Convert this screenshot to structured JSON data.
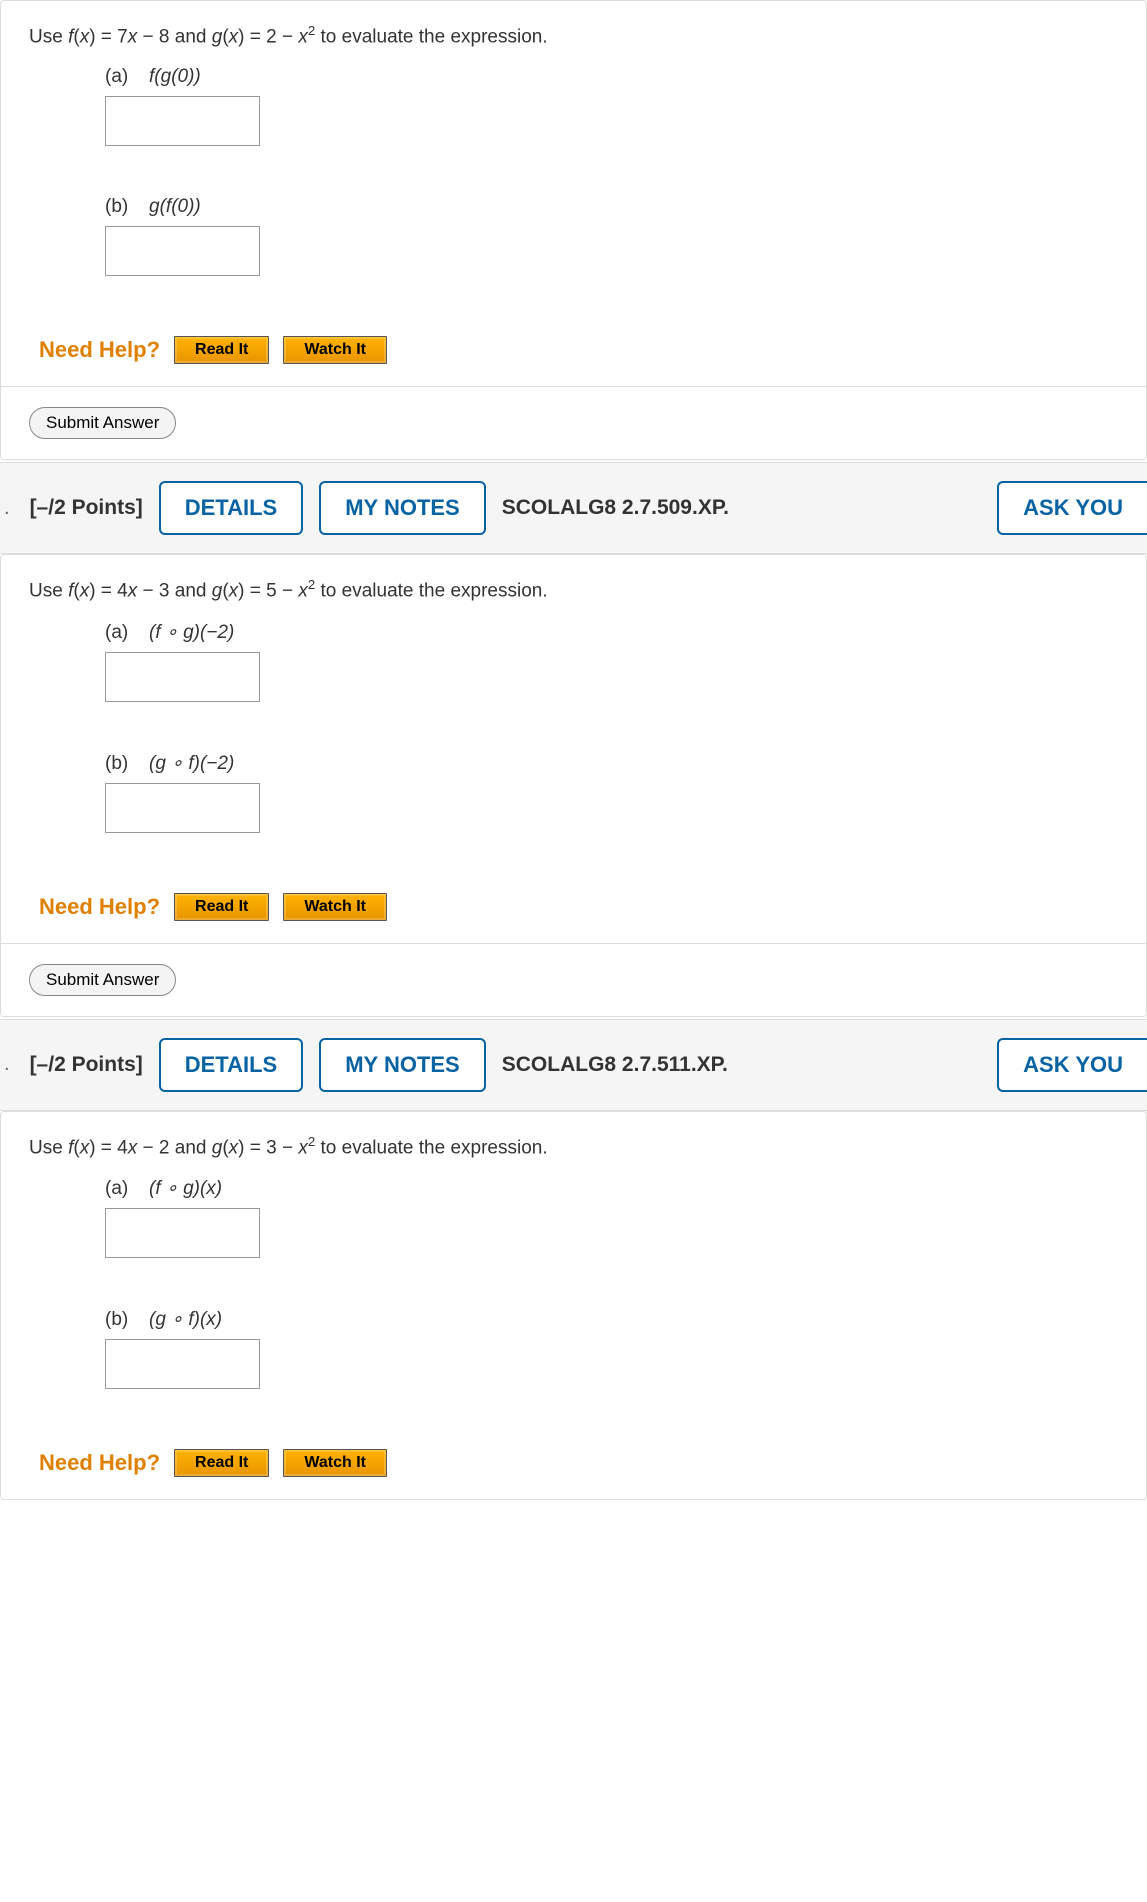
{
  "questions": [
    {
      "prompt_html": "Use <span class='fx'>f</span>(<span class='fx'>x</span>) = 7<span class='fx'>x</span> − 8 and <span class='fx'>g</span>(<span class='fx'>x</span>) = 2 − <span class='fx'>x</span><sup>2</sup> to evaluate the expression.",
      "parts": [
        {
          "label": "(a)",
          "expr_html": "<span class='fx'>f</span>(<span class='fx'>g</span>(0))"
        },
        {
          "label": "(b)",
          "expr_html": "<span class='fx'>g</span>(<span class='fx'>f</span>(0))"
        }
      ],
      "show_header": false
    },
    {
      "points": "[–/2 Points]",
      "reference": "SCOLALG8 2.7.509.XP.",
      "prompt_html": "Use <span class='fx'>f</span>(<span class='fx'>x</span>) = 4<span class='fx'>x</span> − 3 and <span class='fx'>g</span>(<span class='fx'>x</span>) = 5 − <span class='fx'>x</span><sup>2</sup> to evaluate the expression.",
      "parts": [
        {
          "label": "(a)",
          "expr_html": "(<span class='fx'>f</span> ∘ <span class='fx'>g</span>)(−2)"
        },
        {
          "label": "(b)",
          "expr_html": "(<span class='fx'>g</span> ∘ <span class='fx'>f</span>)(−2)"
        }
      ],
      "show_header": true,
      "show_submit": true
    },
    {
      "points": "[–/2 Points]",
      "reference": "SCOLALG8 2.7.511.XP.",
      "prompt_html": "Use <span class='fx'>f</span>(<span class='fx'>x</span>) = 4<span class='fx'>x</span> − 2 and <span class='fx'>g</span>(<span class='fx'>x</span>) = 3 − <span class='fx'>x</span><sup>2</sup> to evaluate the expression.",
      "parts": [
        {
          "label": "(a)",
          "expr_html": "(<span class='fx'>f</span> ∘ <span class='fx'>g</span>)(<span class='fx'>x</span>)"
        },
        {
          "label": "(b)",
          "expr_html": "(<span class='fx'>g</span> ∘ <span class='fx'>f</span>)(<span class='fx'>x</span>)"
        }
      ],
      "show_header": true,
      "show_submit": false
    }
  ],
  "labels": {
    "details": "DETAILS",
    "my_notes": "MY NOTES",
    "ask": "ASK YOU",
    "need_help": "Need Help?",
    "read_it": "Read It",
    "watch_it": "Watch It",
    "submit": "Submit Answer"
  }
}
